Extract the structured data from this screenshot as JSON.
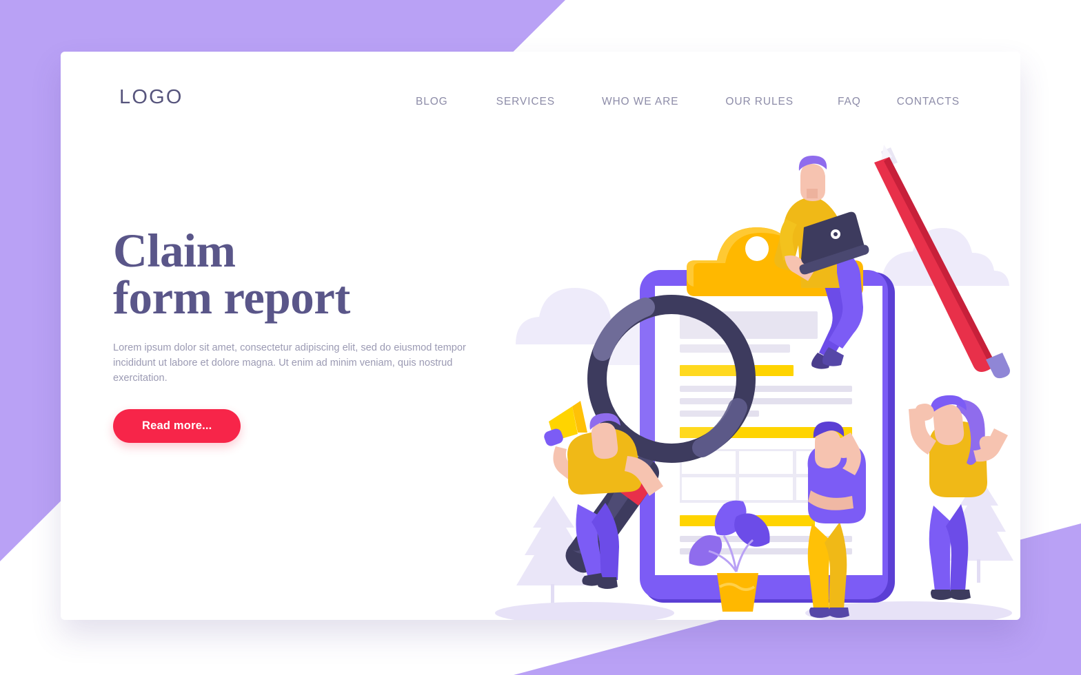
{
  "page": {
    "background_color": "#b9a1f5",
    "card_color": "#ffffff"
  },
  "header": {
    "logo": "LOGO",
    "nav": [
      {
        "label": "BLOG"
      },
      {
        "label": "SERVICES"
      },
      {
        "label": "WHO WE ARE"
      },
      {
        "label": "OUR RULES"
      },
      {
        "label": "FAQ"
      },
      {
        "label": "CONTACTS"
      }
    ]
  },
  "hero": {
    "title_line1": "Claim",
    "title_line2": "form report",
    "subtitle": "Lorem ipsum dolor sit amet, consectetur adipiscing elit, sed do eiusmod tempor incididunt ut labore et dolore magna. Ut enim ad minim veniam, quis nostrud exercitation.",
    "cta_label": "Read more...",
    "title_color": "#5a5689",
    "subtitle_color": "#9b9ab3",
    "cta_color": "#f72549"
  },
  "illustration": {
    "name": "claim-form-clipboard-illustration",
    "elements": [
      "clipboard",
      "clipboard-clip",
      "form-document",
      "magnifying-glass",
      "person-with-laptop",
      "person-with-megaphone",
      "person-thinking",
      "person-with-pencil",
      "potted-plant",
      "background-clouds",
      "background-trees"
    ],
    "colors": {
      "clipboard_purple": "#7c5cf5",
      "clip_yellow": "#ffb800",
      "highlight_yellow": "#ffd400",
      "magnifier_dark": "#3d3b5e",
      "pencil_red": "#e8304a",
      "skin": "#f6c3b0",
      "shirt_yellow": "#f5c518",
      "pants_purple": "#7a5cf0",
      "paper_gray": "#e3e1ee",
      "decor_lavender": "#eeebfa"
    }
  }
}
